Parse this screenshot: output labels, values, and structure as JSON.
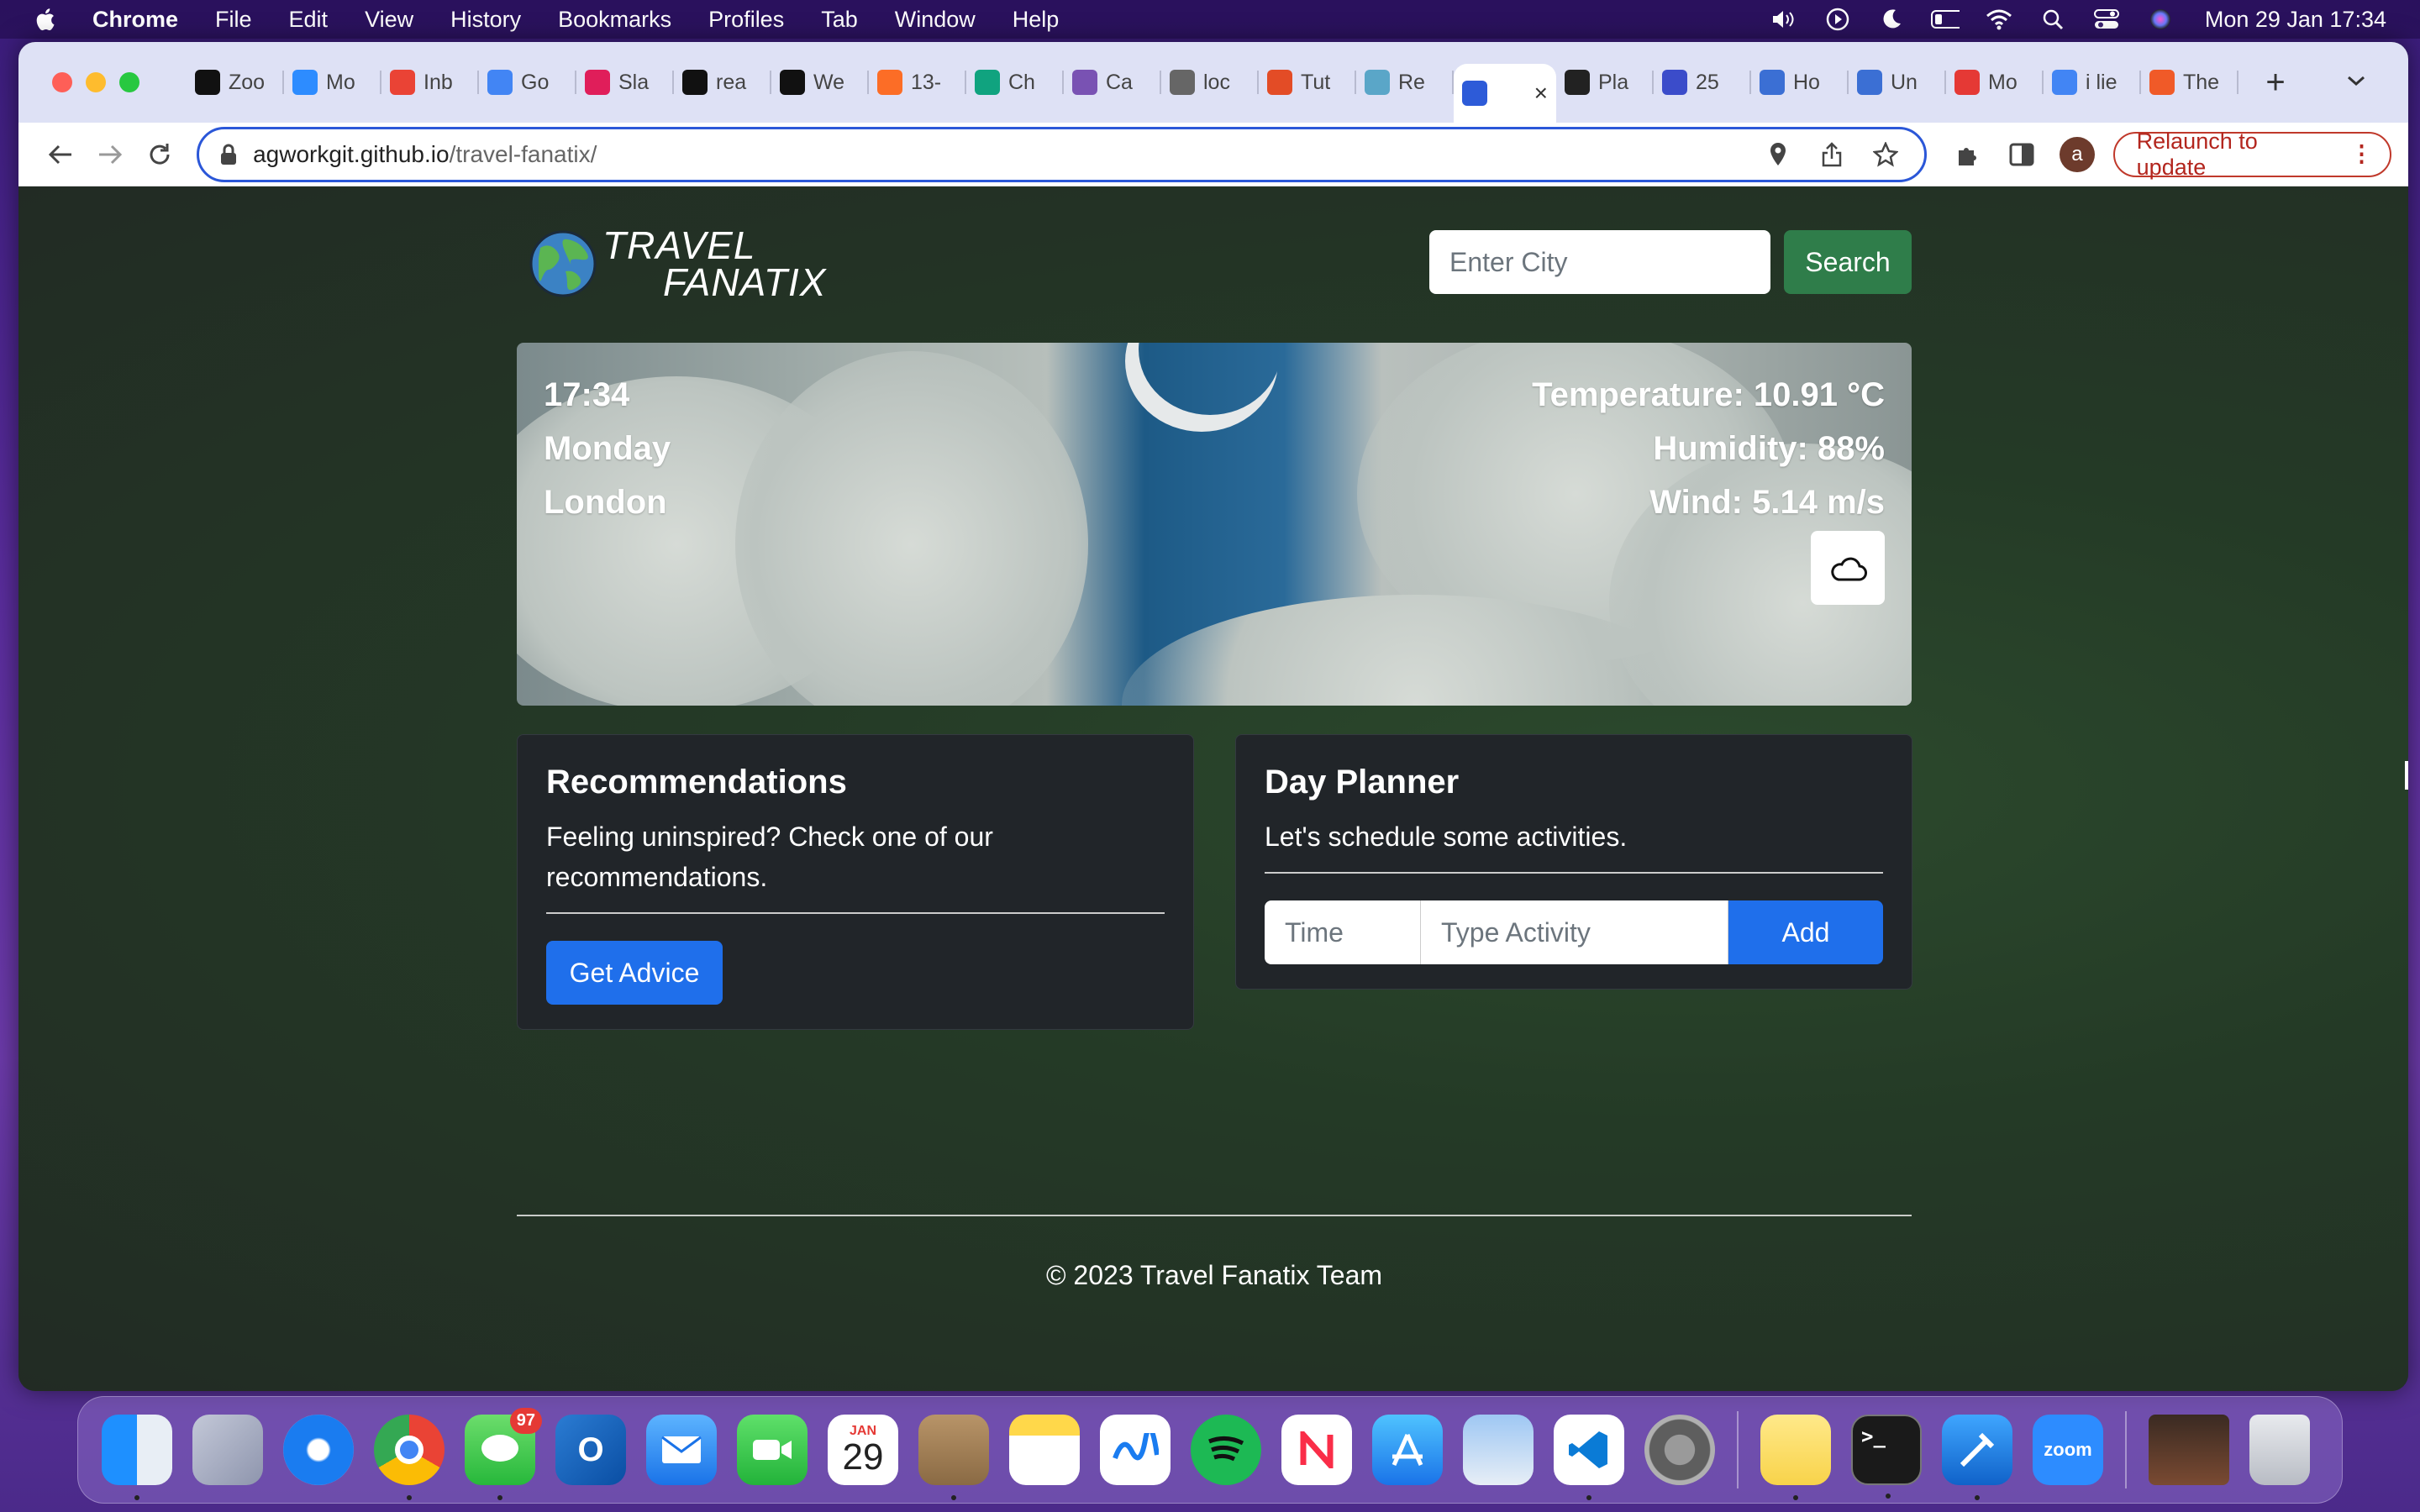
{
  "menubar": {
    "app": "Chrome",
    "items": [
      "File",
      "Edit",
      "View",
      "History",
      "Bookmarks",
      "Profiles",
      "Tab",
      "Window",
      "Help"
    ],
    "clock": "Mon 29 Jan  17:34"
  },
  "tabs": [
    {
      "label": "Zoo",
      "color": "#111111"
    },
    {
      "label": "Mo",
      "color": "#2d8cff"
    },
    {
      "label": "Inb",
      "color": "#ea4335"
    },
    {
      "label": "Go",
      "color": "#4285f4"
    },
    {
      "label": "Sla",
      "color": "#e01e5a"
    },
    {
      "label": "rea",
      "color": "#111111"
    },
    {
      "label": "We",
      "color": "#111111"
    },
    {
      "label": "13-",
      "color": "#fc6d26"
    },
    {
      "label": "Ch",
      "color": "#10a37f"
    },
    {
      "label": "Ca",
      "color": "#7952b3"
    },
    {
      "label": "loc",
      "color": "#666666"
    },
    {
      "label": "Tut",
      "color": "#e34c26"
    },
    {
      "label": "Re",
      "color": "#5aa6c8"
    },
    {
      "label": "",
      "color": "#2d5bd8",
      "active": true
    },
    {
      "label": "Pla",
      "color": "#222222"
    },
    {
      "label": "25",
      "color": "#3b4cca"
    },
    {
      "label": "Ho",
      "color": "#3b6fd4"
    },
    {
      "label": "Un",
      "color": "#3b6fd4"
    },
    {
      "label": "Mo",
      "color": "#e53935"
    },
    {
      "label": "i lie",
      "color": "#4285f4"
    },
    {
      "label": "The",
      "color": "#f05a28"
    }
  ],
  "toolbar": {
    "url_host": "agworkgit.github.io",
    "url_path": "/travel-fanatix/",
    "avatar": "a",
    "relaunch": "Relaunch to update"
  },
  "brand": {
    "line1": "TRAVEL",
    "line2": "FANATIX"
  },
  "search": {
    "placeholder": "Enter City",
    "button": "Search"
  },
  "weather": {
    "time": "17:34",
    "day": "Monday",
    "city": "London",
    "temperature": "Temperature: 10.91 °C",
    "humidity": "Humidity: 88%",
    "wind": "Wind: 5.14 m/s",
    "icon": "cloud-icon"
  },
  "recommendations": {
    "title": "Recommendations",
    "text": "Feeling uninspired? Check one of our recommendations.",
    "button": "Get Advice"
  },
  "planner": {
    "title": "Day Planner",
    "text": "Let's schedule some activities.",
    "time_placeholder": "Time",
    "activity_placeholder": "Type Activity",
    "button": "Add"
  },
  "footer": {
    "text": "© 2023 Travel Fanatix Team"
  },
  "dock": {
    "apps": [
      "finder",
      "launchpad",
      "safari",
      "chrome",
      "messages",
      "outlook",
      "mail",
      "facetime",
      "calendar",
      "contacts",
      "notes",
      "freeform",
      "spotify",
      "news",
      "app-store",
      "preview",
      "vscode",
      "system-settings",
      "stickies",
      "terminal",
      "xcode",
      "zoom",
      "photos",
      "trash"
    ],
    "messages_badge": "97",
    "calendar_month": "JAN",
    "calendar_day": "29",
    "zoom_label": "zoom"
  }
}
